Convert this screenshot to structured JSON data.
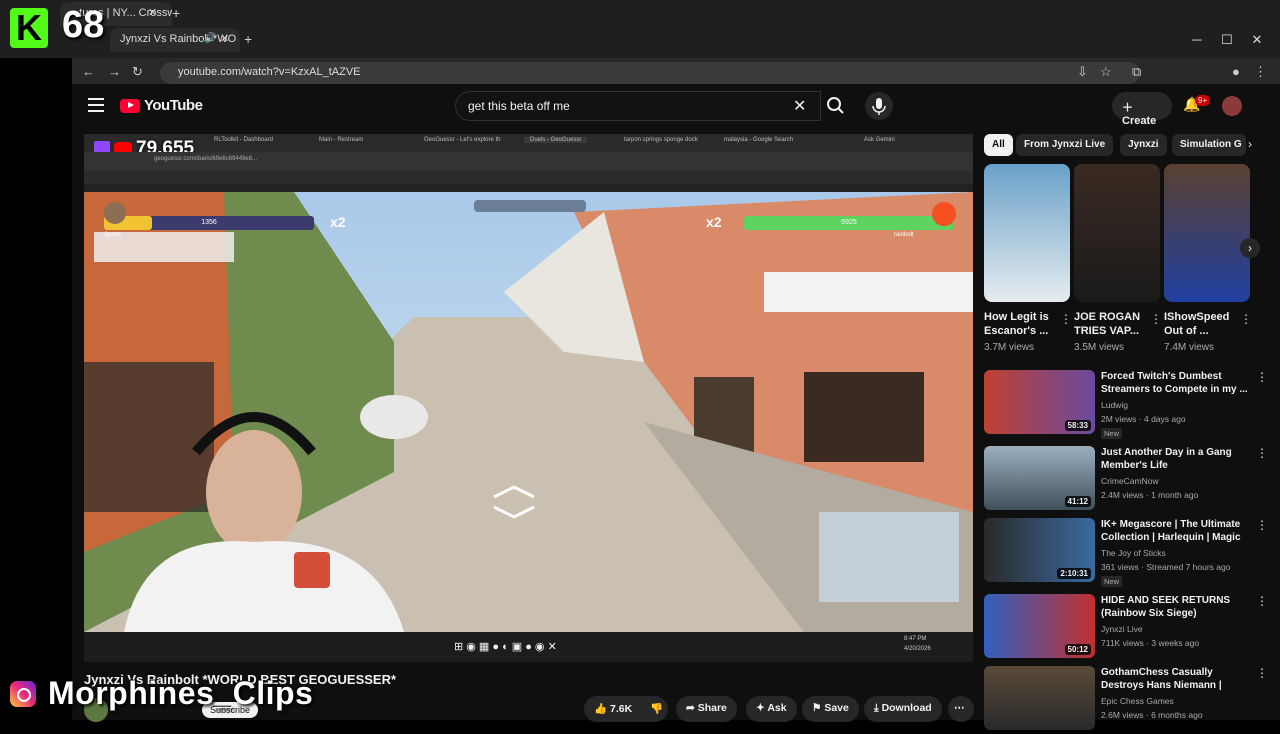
{
  "overlay": {
    "kick_count": "68",
    "instagram_handle": "Morphines_Clips"
  },
  "browser": {
    "tab1_title": "...tures | NY... Crossword",
    "tab2_title": "Jynxzi Vs Rainbolt *WO",
    "url": "youtube.com/watch?v=KzxAL_tAZVE"
  },
  "youtube": {
    "search_query": "get this beta off me",
    "create_label": "Create",
    "notif_count": "9+",
    "logo_text": "YouTube"
  },
  "player": {
    "viewer_count": "79,655",
    "inner_tabs": [
      "RLToolkit - Dashboard",
      "Main - Restream",
      "GeoGuessr - Let's explore th",
      "Duels - GeoGuessr",
      "tarpon springs sponge dock",
      "malaysia - Google Search"
    ],
    "inner_url": "geoguessr.com/duels/69e6c69449e8...",
    "ask_label": "Ask Gemini",
    "player1": {
      "name": "Jynxzi",
      "hp": "1356",
      "multiplier": "x2"
    },
    "player2": {
      "name": "rainbolt",
      "hp": "5925",
      "multiplier": "x2"
    },
    "hp_fraction_p1": 0.23,
    "hp_fraction_p2": 1.0,
    "taskbar_time": "8:47 PM",
    "taskbar_date": "4/20/2026"
  },
  "video": {
    "title": "Jynxzi Vs Rainbolt *WORLD BEST GEOGUESSER*",
    "subscribe_label": "Subscribe",
    "likes": "7.6K",
    "share_label": "Share",
    "ask_label": "Ask",
    "save_label": "Save",
    "download_label": "Download"
  },
  "chips": [
    "All",
    "From Jynxzi Live",
    "Jynxzi",
    "Simulation G"
  ],
  "shorts": [
    {
      "title": "How Legit is Escanor's ...",
      "views": "3.7M views"
    },
    {
      "title": "JOE ROGAN TRIES VAP...",
      "views": "3.5M views"
    },
    {
      "title": "IShowSpeed Out of ...",
      "views": "7.4M views"
    }
  ],
  "recommendations": [
    {
      "title": "Forced Twitch's Dumbest Streamers to Compete in my ...",
      "channel": "Ludwig",
      "meta": "2M views · 4 days ago",
      "new": "New",
      "duration": "58:33"
    },
    {
      "title": "Just Another Day in a Gang Member's Life",
      "channel": "CrimeCamNow",
      "meta": "2.4M views · 1 month ago",
      "new": "",
      "duration": "41:12"
    },
    {
      "title": "IK+ Megascore | The Ultimate Collection | Harlequin | Magic ...",
      "channel": "The Joy of Sticks",
      "meta": "361 views · Streamed 7 hours ago",
      "new": "New",
      "duration": "2:10:31"
    },
    {
      "title": "HIDE AND SEEK RETURNS (Rainbow Six Siege)",
      "channel": "Jynxzi Live",
      "meta": "711K views · 3 weeks ago",
      "new": "",
      "duration": "50:12"
    },
    {
      "title": "GothamChess Casually Destroys Hans Niemann | Title...",
      "channel": "Epic Chess Games",
      "meta": "2.6M views · 6 months ago",
      "new": "",
      "duration": ""
    }
  ]
}
